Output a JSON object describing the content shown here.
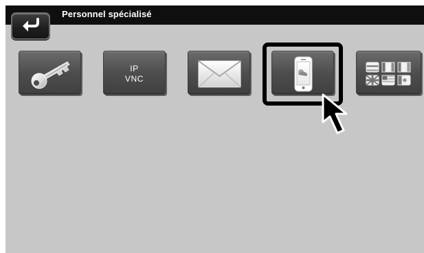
{
  "header": {
    "title": "Personnel spécialisé"
  },
  "tiles": [
    {
      "name": "tile-service-code",
      "icon": "key-icon"
    },
    {
      "name": "tile-ip-vnc",
      "label_line_1": "IP",
      "label_line_2": "VNC"
    },
    {
      "name": "tile-email",
      "icon": "envelope-icon"
    },
    {
      "name": "tile-mobile-app",
      "icon": "smartphone-icon",
      "selected": true
    },
    {
      "name": "tile-language",
      "icon": "flags-icon"
    }
  ],
  "colors": {
    "background": "#c7c7c7",
    "header": "#0f0f0f",
    "tile": "#505050",
    "highlight": "#000000"
  }
}
